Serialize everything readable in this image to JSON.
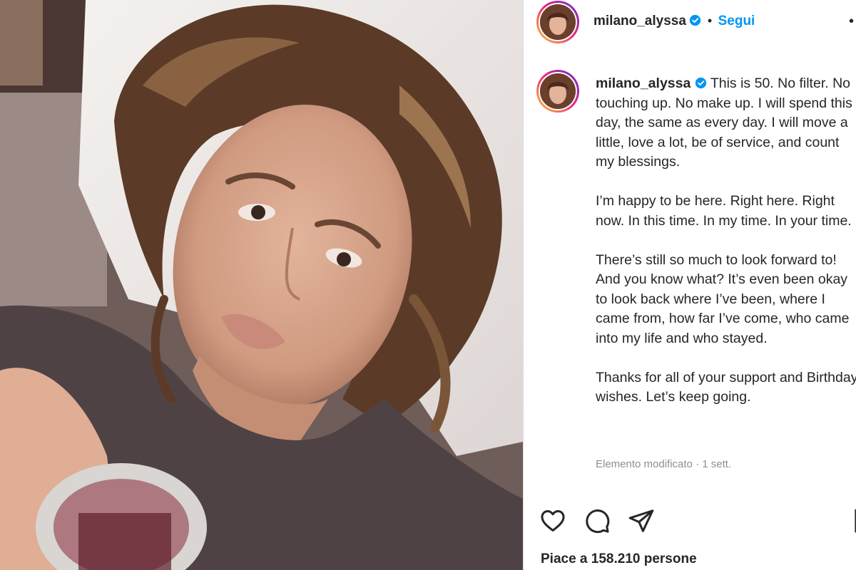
{
  "post": {
    "username": "milano_alyssa",
    "follow_separator": "•",
    "follow_label": "Segui",
    "more_glyph": "•",
    "caption_paragraphs": [
      "This is 50. No filter. No touching up. No make up. I will spend this day, the same as every day. I will move a little, love a lot, be of service, and count my blessings.",
      "I’m happy to be here. Right here. Right now. In this time. In my time. In your time.",
      "There’s still so much to look forward to! And you know what? It’s even been okay to look back where I’ve been, where I came from, how far I’ve come, who came into my life and who stayed.",
      "Thanks for all of your support and Birthday wishes. Let’s keep going."
    ],
    "edited_label": "Elemento modificato",
    "meta_separator": "·",
    "time_ago": "1 sett.",
    "likes_text": "Piace a 158.210 persone"
  },
  "icons": {
    "verified": "verified-badge-icon",
    "like": "heart-icon",
    "comment": "comment-icon",
    "share": "paper-plane-icon",
    "save": "bookmark-icon"
  },
  "colors": {
    "accent": "#0095f6",
    "text": "#262626",
    "muted": "#8e8e8e"
  }
}
